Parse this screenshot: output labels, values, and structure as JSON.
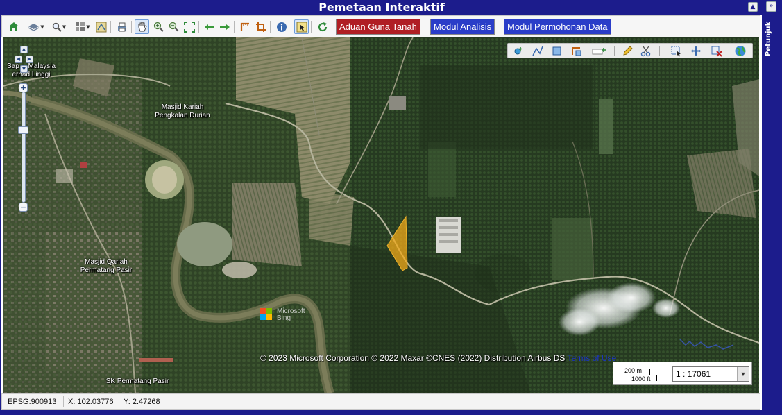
{
  "header": {
    "title": "Pemetaan Interaktif"
  },
  "side_panel": {
    "label": "Petunjuk"
  },
  "toolbar": {
    "icons": [
      "home-icon",
      "layers-icon",
      "search-icon",
      "grid-icon",
      "legend-icon",
      "print-icon",
      "pan-hand-icon",
      "zoom-in-icon",
      "zoom-out-icon",
      "full-extent-icon",
      "back-arrow-icon",
      "forward-arrow-icon",
      "measure-icon",
      "crop-icon",
      "info-icon",
      "select-icon",
      "refresh-icon"
    ],
    "buttons": [
      {
        "label": "Aduan Guna Tanah",
        "color": "#b01e24"
      },
      {
        "label": "Modul Analisis",
        "color": "#2a3dc8"
      },
      {
        "label": "Modul Permohonan Data",
        "color": "#2a3dc8"
      }
    ]
  },
  "map": {
    "place_labels": [
      {
        "text": "Sap… Malaysia\nerhad Linggi"
      },
      {
        "text": "Masjid Kariah\nPengkalan Durian"
      },
      {
        "text": "Masjid Qariah\nPermatang Pasir"
      },
      {
        "text": "SK Permatang Pasir"
      }
    ],
    "highlight_color": "#f2a91a",
    "logo_text": [
      "Microsoft",
      "Bing"
    ],
    "attribution": "© 2023 Microsoft Corporation © 2022 Maxar ©CNES (2022) Distribution Airbus DS",
    "terms_link": "Terms of Use",
    "edit_tools": [
      "add-point-icon",
      "add-line-icon",
      "add-polygon-icon",
      "edit-vertex-icon",
      "add-feature-icon",
      "draw-pencil-icon",
      "cut-icon",
      "select-box-icon",
      "move-icon",
      "delete-icon",
      "globe-icon"
    ]
  },
  "scale": {
    "bar_top": "200 m",
    "bar_bottom": "1000 ft",
    "ratio": "1 : 17061"
  },
  "status": {
    "projection": "EPSG:900913",
    "x_label": "X: 102.03776",
    "y_label": "Y: 2.47268"
  }
}
